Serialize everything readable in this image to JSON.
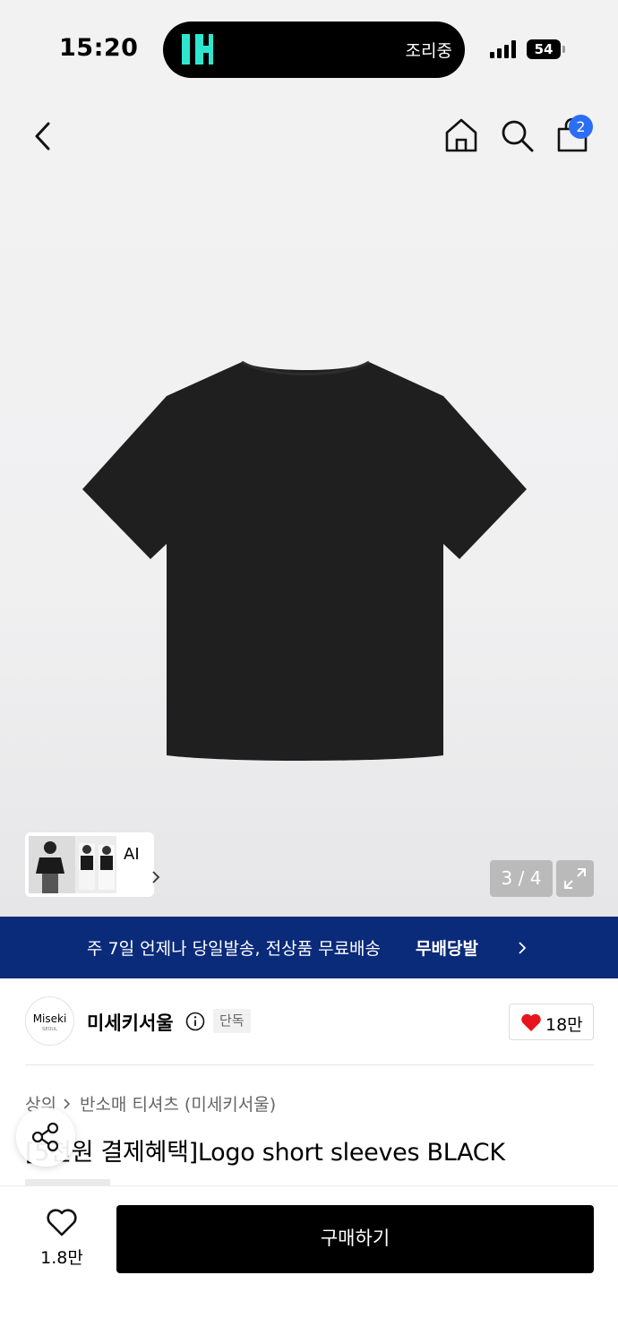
{
  "status_bar": {
    "time": "15:20",
    "island_activity": "조리중",
    "battery": "54"
  },
  "product_gallery": {
    "cart_count": "2",
    "ai_label": "AI",
    "page_indicator": "3 / 4",
    "product_color": "#1f1f1f"
  },
  "banner": {
    "text": "주 7일 언제나 당일발송, 전상품 무료배송",
    "service_name": "무배당발",
    "background": "#0a2a7a"
  },
  "brand": {
    "logo_text": "Miseki",
    "logo_subtext": "SEOUL",
    "name": "미세키서울",
    "badge": "단독",
    "like_count": "18만"
  },
  "breadcrumb": [
    "상의",
    "반소매 티셔츠 (미세키서울)"
  ],
  "product": {
    "title": "[5천원 결제혜택]Logo short sleeves BLACK"
  },
  "bottom_bar": {
    "wish_count": "1.8만",
    "buy_label": "구매하기"
  },
  "icons": [
    "back-icon",
    "home-icon",
    "search-icon",
    "shopping-bag-icon",
    "chevron-right-icon",
    "expand-icon",
    "info-icon",
    "heart-icon",
    "share-icon"
  ]
}
